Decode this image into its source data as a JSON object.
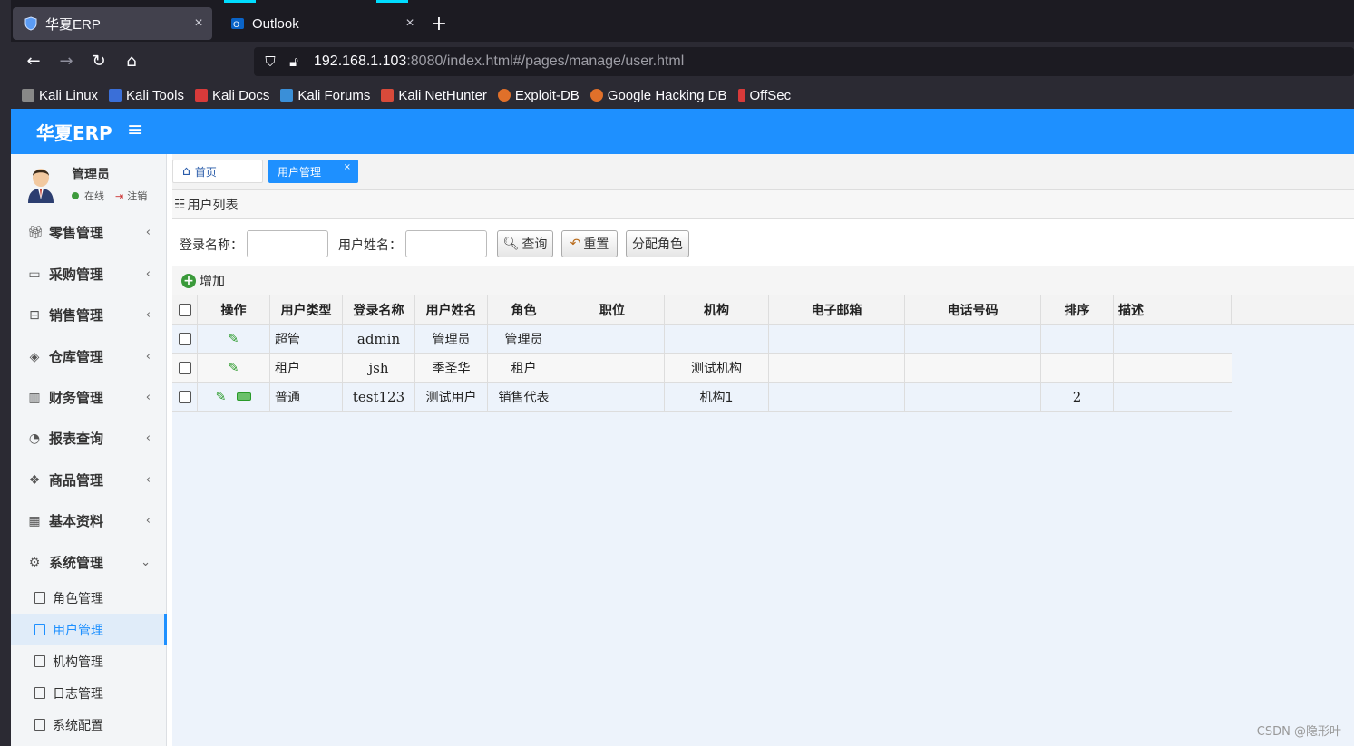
{
  "browser": {
    "tabs": [
      {
        "title": "华夏ERP",
        "close": "×"
      },
      {
        "title": "Outlook",
        "close": "×"
      }
    ],
    "new_tab": "+",
    "url_host": "192.168.1.103",
    "url_rest": ":8080/index.html#/pages/manage/user.html",
    "bookmarks": [
      "Kali Linux",
      "Kali Tools",
      "Kali Docs",
      "Kali Forums",
      "Kali NetHunter",
      "Exploit-DB",
      "Google Hacking DB",
      "OffSec"
    ]
  },
  "app": {
    "logo": "华夏ERP",
    "menu_icon": "≡",
    "user": {
      "name": "管理员",
      "status": "在线",
      "logout": "注销"
    },
    "menu": [
      {
        "label": "零售管理",
        "icon": "gift-icon"
      },
      {
        "label": "采购管理",
        "icon": "chat-icon"
      },
      {
        "label": "销售管理",
        "icon": "briefcase-icon"
      },
      {
        "label": "仓库管理",
        "icon": "layers-icon"
      },
      {
        "label": "财务管理",
        "icon": "book-icon"
      },
      {
        "label": "报表查询",
        "icon": "pie-icon"
      },
      {
        "label": "商品管理",
        "icon": "cubes-icon"
      },
      {
        "label": "基本资料",
        "icon": "grid-icon"
      },
      {
        "label": "系统管理",
        "icon": "gear-icon"
      }
    ],
    "submenu": [
      "角色管理",
      "用户管理",
      "机构管理",
      "日志管理",
      "系统配置"
    ],
    "page_tabs": {
      "home": "首页",
      "current": "用户管理",
      "close": "×"
    },
    "panel_title": "用户列表",
    "search": {
      "login_label": "登录名称：",
      "name_label": "用户姓名：",
      "query_btn": "查询",
      "reset_btn": "重置",
      "assign_btn": "分配角色"
    },
    "toolbar": {
      "add": "增加",
      "add_icon": "+"
    },
    "table": {
      "headers": [
        "操作",
        "用户类型",
        "登录名称",
        "用户姓名",
        "角色",
        "职位",
        "机构",
        "电子邮箱",
        "电话号码",
        "排序",
        "描述"
      ],
      "rows": [
        {
          "type": "超管",
          "login": "admin",
          "name": "管理员",
          "role": "管理员",
          "position": "",
          "org": "",
          "email": "",
          "phone": "",
          "sort": "",
          "desc": ""
        },
        {
          "type": "租户",
          "login": "jsh",
          "name": "季圣华",
          "role": "租户",
          "position": "",
          "org": "测试机构",
          "email": "",
          "phone": "",
          "sort": "",
          "desc": ""
        },
        {
          "type": "普通",
          "login": "test123",
          "name": "测试用户",
          "role": "销售代表",
          "position": "",
          "org": "机构1",
          "email": "",
          "phone": "",
          "sort": "2",
          "desc": ""
        }
      ]
    },
    "watermark": "CSDN @隐形叶"
  },
  "colors": {
    "brand": "#1e90ff",
    "browser_bg": "#1c1b22"
  }
}
